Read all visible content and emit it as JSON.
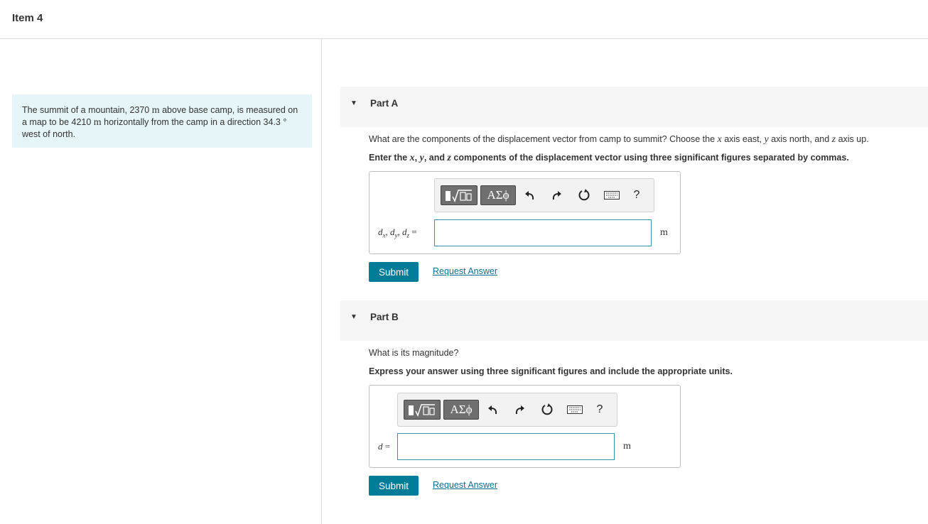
{
  "header": {
    "title": "Item 4"
  },
  "problem": {
    "seg1": "The summit of a mountain, 2370 ",
    "unit1": "m",
    "seg2": " above base camp, is measured on a map to be 4210 ",
    "unit2": "m",
    "seg3": " horizontally from the camp in a direction 34.3 ",
    "deg": "°",
    "seg4": " west of north."
  },
  "partA": {
    "label": "Part A",
    "question": {
      "p1": "What are the components of the displacement vector from camp to summit? Choose the ",
      "x": "x",
      "p2": " axis east, ",
      "y": "y",
      "p3": " axis north, and ",
      "z": "z",
      "p4": " axis up."
    },
    "instruction": {
      "p1": "Enter the ",
      "x": "x",
      "c1": ", ",
      "y": "y",
      "c2": ", and ",
      "z": "z",
      "p2": " components of the displacement vector using three significant figures separated by commas."
    },
    "answer_label": {
      "d1": "d",
      "s1": "x",
      "sep1": ", ",
      "d2": "d",
      "s2": "y",
      "sep2": ", ",
      "d3": "d",
      "s3": "z",
      "eq": " ="
    },
    "input_value": "",
    "unit": "m",
    "submit_label": "Submit",
    "request_label": "Request Answer"
  },
  "partB": {
    "label": "Part B",
    "question": "What is its magnitude?",
    "instruction": "Express your answer using three significant figures and include the appropriate units.",
    "answer_label": {
      "d": "d",
      "eq": " ="
    },
    "input_value": "",
    "unit": "m",
    "submit_label": "Submit",
    "request_label": "Request Answer"
  },
  "toolbar": {
    "greek_label": "ΑΣϕ",
    "help_label": "?",
    "icons": [
      "templates-icon",
      "greek-symbols-icon",
      "undo-icon",
      "redo-icon",
      "reset-icon",
      "keyboard-icon",
      "help-icon"
    ]
  }
}
